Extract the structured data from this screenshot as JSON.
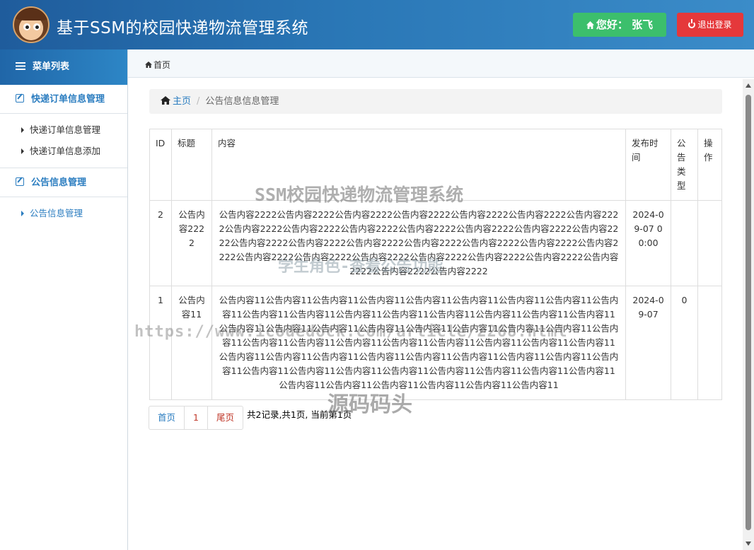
{
  "header": {
    "title": "基于SSM的校园快递物流管理系统",
    "greeting": "您好：  张飞",
    "logout": "退出登录",
    "colors": {
      "greet_bg": "#3cbf6c",
      "logout_bg": "#e5383b"
    }
  },
  "sidebar": {
    "menu_title": "菜单列表",
    "groups": [
      {
        "label": "快递订单信息管理",
        "items": [
          "快递订单信息管理",
          "快递订单信息添加"
        ]
      },
      {
        "label": "公告信息管理",
        "items": [
          "公告信息管理"
        ]
      }
    ]
  },
  "tabbar": {
    "home": "首页"
  },
  "breadcrumb": {
    "home": "主页",
    "current": "公告信息信息管理"
  },
  "table": {
    "headers": [
      "ID",
      "标题",
      "内容",
      "发布时间",
      "公告类型",
      "操作"
    ],
    "rows": [
      {
        "id": "2",
        "title": "公告内容2222",
        "content": "公告内容2222公告内容2222公告内容2222公告内容2222公告内容2222公告内容2222公告内容2222公告内容2222公告内容2222公告内容2222公告内容2222公告内容2222公告内容2222公告内容2222公告内容2222公告内容2222公告内容2222公告内容2222公告内容2222公告内容2222公告内容2222公告内容2222公告内容2222公告内容2222公告内容2222公告内容2222公告内容2222公告内容2222公告内容2222公告内容2222",
        "time": "2024-09-07 00:00",
        "type": "",
        "action": ""
      },
      {
        "id": "1",
        "title": "公告内容11",
        "content": "公告内容11公告内容11公告内容11公告内容11公告内容11公告内容11公告内容11公告内容11公告内容11公告内容11公告内容11公告内容11公告内容11公告内容11公告内容11公告内容11公告内容11公告内容11公告内容11公告内容11公告内容11公告内容11公告内容11公告内容11公告内容11公告内容11公告内容11公告内容11公告内容11公告内容11公告内容11公告内容11公告内容11公告内容11公告内容11公告内容11公告内容11公告内容11公告内容11公告内容11公告内容11公告内容11公告内容11公告内容11公告内容11公告内容11公告内容11公告内容11公告内容11公告内容11公告内容11公告内容11公告内容11公告内容11公告内容11公告内容11公告内容11",
        "time": "2024-09-07",
        "type": "0",
        "action": ""
      }
    ]
  },
  "pager": {
    "first": "首页",
    "page": "1",
    "last": "尾页",
    "info": "共2记录,共1页, 当前第1页"
  },
  "watermarks": {
    "line1": "SSM校园快递物流管理系统",
    "line2": "学生角色-查看公告功能",
    "line3": "https://www.icodedock.com/article/2268.html",
    "line4": "源码码头"
  }
}
